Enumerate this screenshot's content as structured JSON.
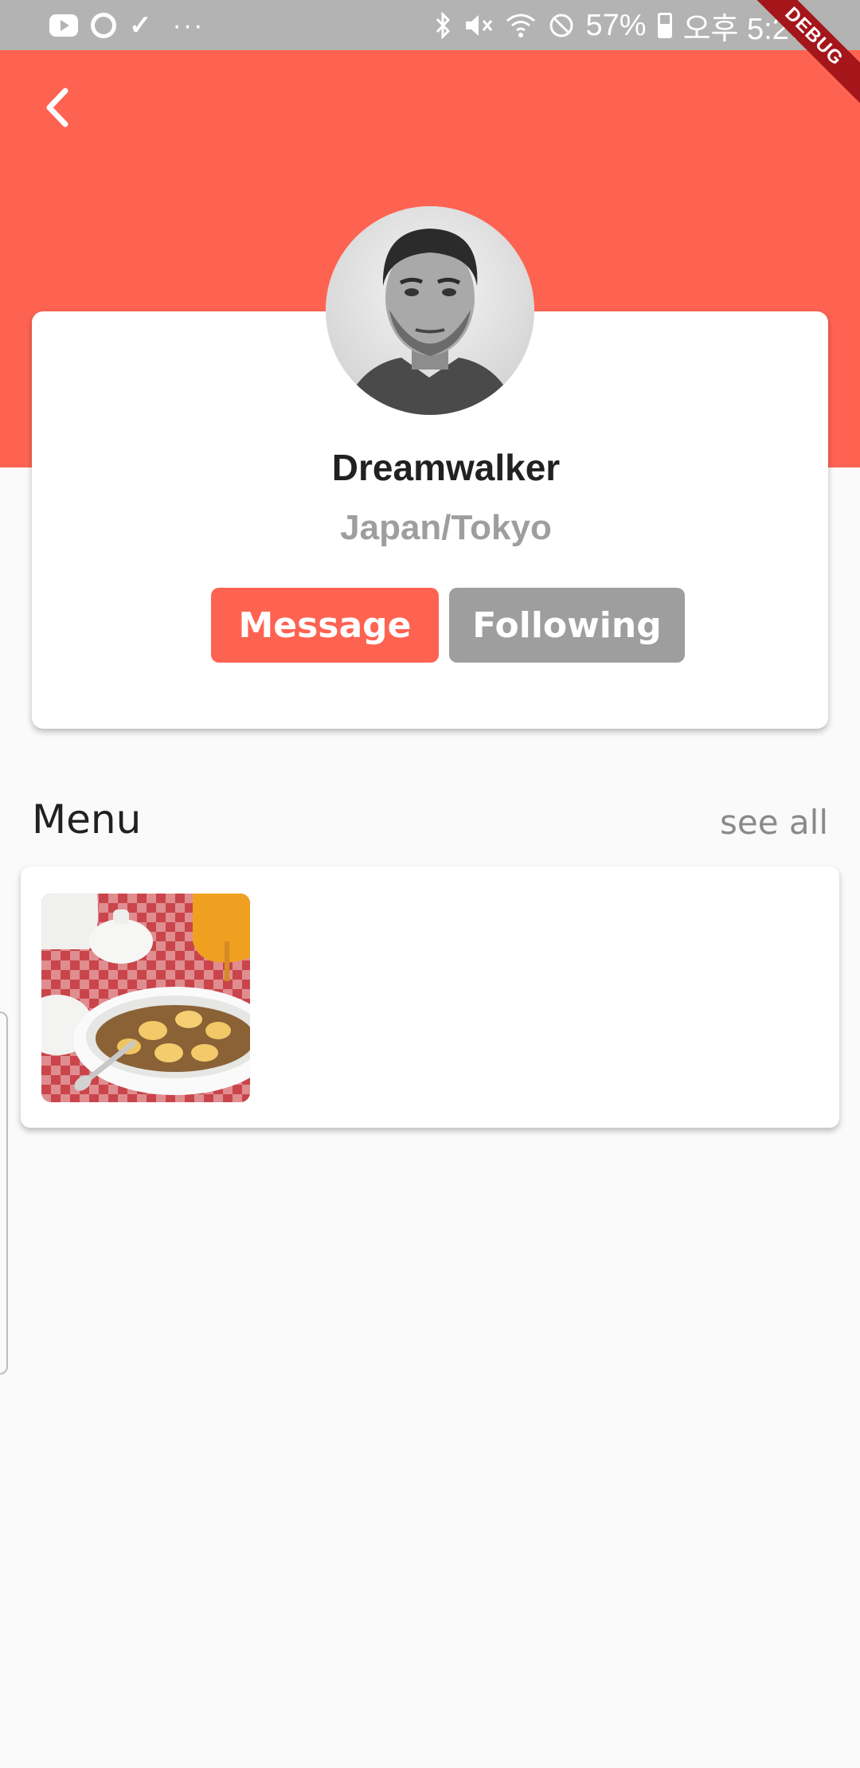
{
  "status_bar": {
    "battery": "57%",
    "time": "오후 5:27",
    "left_icons": [
      "youtube-icon",
      "app-icon",
      "check-icon",
      "more-dots-icon"
    ],
    "right_icons": [
      "bluetooth-icon",
      "mute-icon",
      "wifi-icon",
      "no-disturb-icon",
      "battery-icon"
    ]
  },
  "debug_banner": "DEBUG",
  "header": {
    "back_icon": "chevron-left-icon",
    "color": "#fe6352"
  },
  "profile": {
    "name": "Dreamwalker",
    "location": "Japan/Tokyo",
    "message_label": "Message",
    "following_label": "Following"
  },
  "menu": {
    "title": "Menu",
    "see_all_label": "see all",
    "items": [
      {
        "image": "cereal-banana-bowl"
      }
    ]
  },
  "colors": {
    "accent": "#fe6352",
    "secondary": "#9e9e9e",
    "background": "#fafafa"
  }
}
